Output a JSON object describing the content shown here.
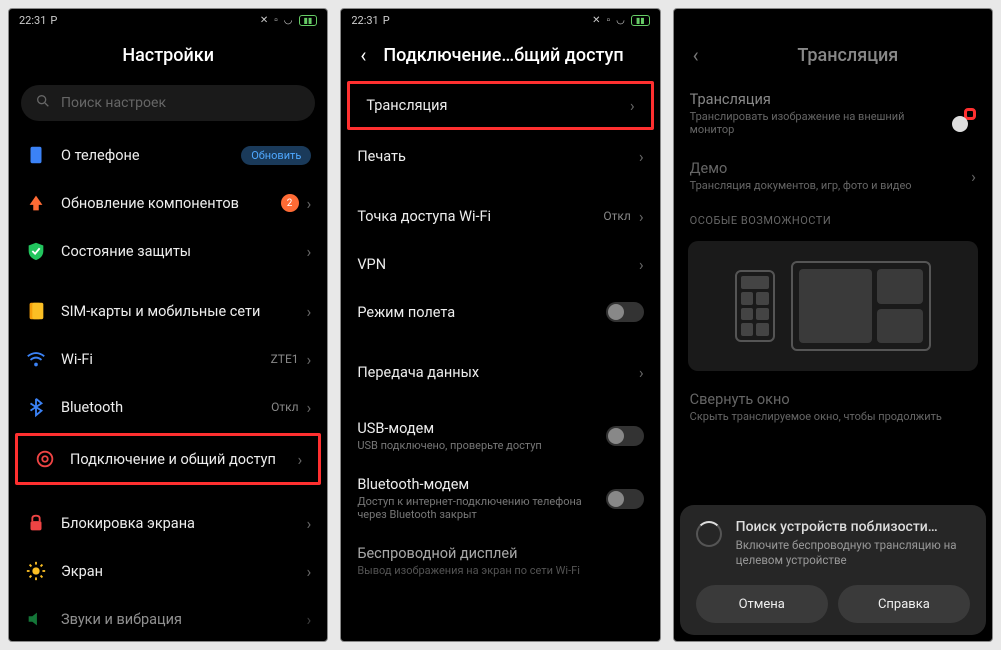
{
  "status": {
    "time": "22:31",
    "p_icon": "P",
    "battery_pct": ""
  },
  "screen1": {
    "title": "Настройки",
    "search_placeholder": "Поиск настроек",
    "items": [
      {
        "label": "О телефоне",
        "pill": "Обновить"
      },
      {
        "label": "Обновление компонентов",
        "badge": "2"
      },
      {
        "label": "Состояние защиты"
      },
      {
        "label": "SIM-карты и мобильные сети"
      },
      {
        "label": "Wi-Fi",
        "value": "ZTE1"
      },
      {
        "label": "Bluetooth",
        "value": "Откл"
      },
      {
        "label": "Подключение и общий доступ"
      },
      {
        "label": "Блокировка экрана"
      },
      {
        "label": "Экран"
      },
      {
        "label": "Звуки и вибрация"
      }
    ]
  },
  "screen2": {
    "title": "Подключение…бщий доступ",
    "items": [
      {
        "label": "Трансляция"
      },
      {
        "label": "Печать"
      },
      {
        "label": "Точка доступа Wi-Fi",
        "value": "Откл"
      },
      {
        "label": "VPN"
      },
      {
        "label": "Режим полета",
        "toggle": false
      },
      {
        "label": "Передача данных"
      },
      {
        "label": "USB-модем",
        "sub": "USB подключено, проверьте доступ",
        "toggle": false
      },
      {
        "label": "Bluetooth-модем",
        "sub": "Доступ к интернет-подключению телефона через Bluetooth закрыт",
        "toggle": false
      },
      {
        "label": "Беспроводной дисплей",
        "sub": "Вывод изображения на экран по сети Wi-Fi"
      }
    ]
  },
  "screen3": {
    "title": "Трансляция",
    "items": [
      {
        "label": "Трансляция",
        "sub": "Транслировать изображение на внешний монитор",
        "toggle": true
      },
      {
        "label": "Демо",
        "sub": "Трансляция документов, игр, фото и видео"
      }
    ],
    "section": "ОСОБЫЕ ВОЗМОЖНОСТИ",
    "collapse": {
      "label": "Свернуть окно",
      "sub": "Скрыть транслируемое окно, чтобы продолжить"
    },
    "dialog": {
      "title": "Поиск устройств поблизости…",
      "sub": "Включите беспроводную трансляцию на целевом устройстве",
      "cancel": "Отмена",
      "help": "Справка"
    }
  }
}
